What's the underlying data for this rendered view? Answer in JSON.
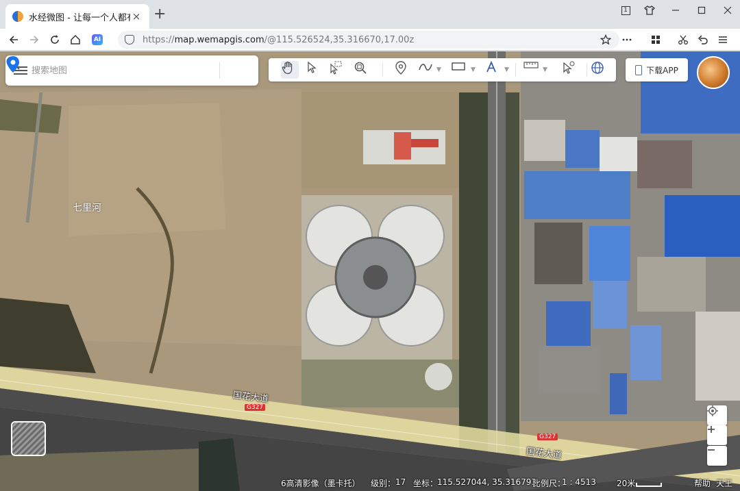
{
  "browser": {
    "tab_title": "水经微图 - 让每一个人都有自",
    "tab_close": "×",
    "new_tab": "+",
    "url_prefix": "https://",
    "url_domain": "map.wemapgis.com",
    "url_rest": "/@115.526524,35.316670,17.00z",
    "tab_count": "1",
    "ai_label": "AI"
  },
  "search": {
    "placeholder": "搜索地图"
  },
  "toolbar": {
    "download_label": "下载APP"
  },
  "map": {
    "place_label": "七里河",
    "road_name_1": "国花大道",
    "road_name_2": "国花大道",
    "road_shield_1": "G327",
    "road_shield_2": "G327"
  },
  "status": {
    "imagery": "6高清影像（墨卡托）",
    "level_label": "级别：",
    "level_value": "17",
    "coord_label": "坐标：",
    "coord_value": "115.527044, 35.316793",
    "scale_label": "比例尺：",
    "scale_value": "1 : 4513",
    "scalebar_label": "20米",
    "help": "帮助",
    "sky": "天王"
  },
  "colors": {
    "accent": "#1a73e8",
    "marker": "#1a73e8",
    "road": "#e8dfa4",
    "field": "#a9987b"
  }
}
